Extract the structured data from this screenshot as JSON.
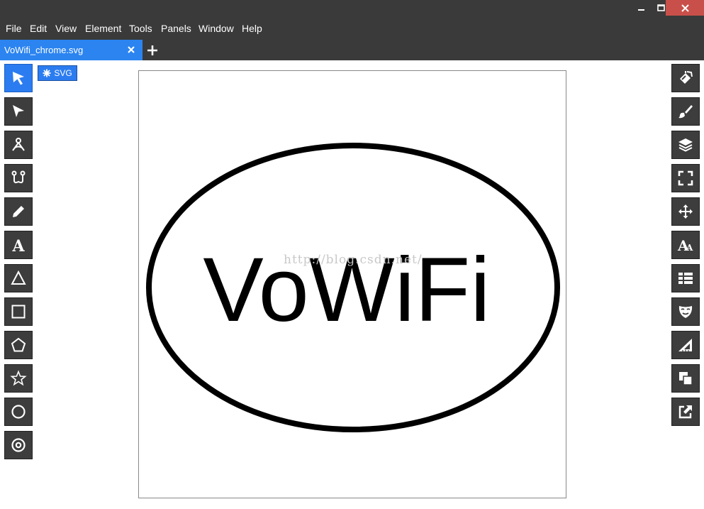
{
  "window": {
    "minimize_label": "–",
    "maximize_label": "□",
    "close_label": "✕"
  },
  "menu": {
    "items": [
      "File",
      "Edit",
      "View",
      "Element",
      "Tools",
      "Panels",
      "Window",
      "Help"
    ]
  },
  "tabs": {
    "active_file": "VoWifi_chrome.svg"
  },
  "breadcrumb": {
    "label": "SVG",
    "icon": "asterisk-icon"
  },
  "left_tools": [
    "selection-arrow-icon",
    "node-arrow-icon",
    "transform-icon",
    "edit-nodes-icon",
    "pencil-icon",
    "text-tool-icon",
    "triangle-icon",
    "rectangle-icon",
    "pentagon-icon",
    "star-icon",
    "circle-icon",
    "ring-icon"
  ],
  "right_panels": [
    "fill-bucket-icon",
    "brush-icon",
    "layers-icon",
    "fullscreen-icon",
    "move-icon",
    "font-size-icon",
    "list-icon",
    "mask-icon",
    "ruler-icon",
    "arrange-icon",
    "export-icon"
  ],
  "canvas": {
    "logo_text": "VoWiFi",
    "watermark": "http://blog.csdn.net/"
  },
  "colors": {
    "chrome": "#3a3a3a",
    "accent": "#2b7cf0",
    "close": "#c9504a"
  }
}
